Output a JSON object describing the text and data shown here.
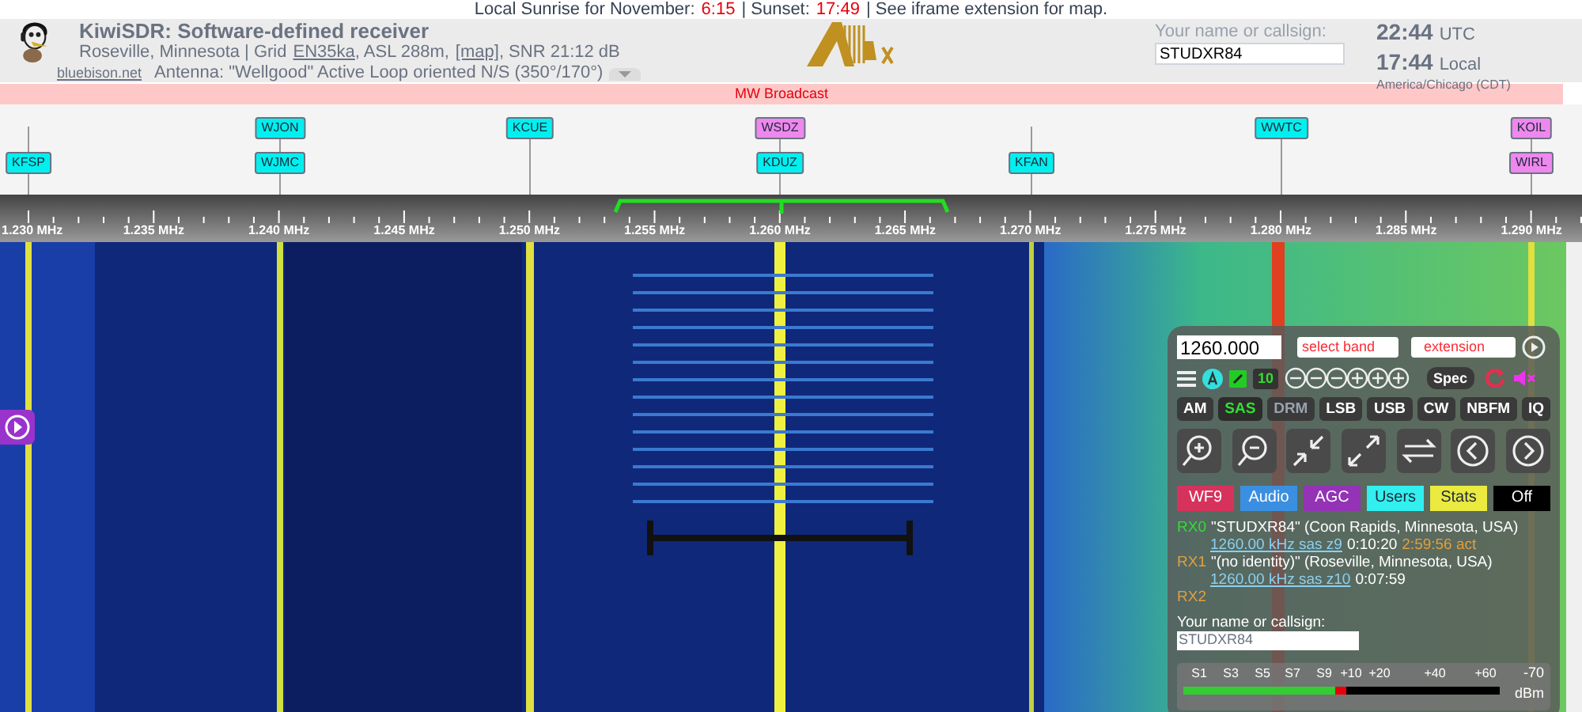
{
  "sun_line": {
    "sunrise_label": "Local Sunrise for November:",
    "sunrise": "6:15",
    "sunset_label": "| Sunset:",
    "sunset": "17:49",
    "note": "| See iframe extension for map."
  },
  "header": {
    "title": "KiwiSDR: Software-defined receiver",
    "location": "Roseville, Minnesota | Grid",
    "grid": "EN35ka",
    "asl": ", ASL 288m,",
    "map": "[map]",
    "snr": ", SNR 21:12 dB",
    "site": "bluebison.net",
    "antenna": "Antenna: \"Wellgood\" Active Loop oriented N/S (350°/170°)",
    "name_label": "Your name or callsign:",
    "name_value": "STUDXR84",
    "utc_time": "22:44",
    "utc_label": "UTC",
    "local_time": "17:44",
    "local_label": "Local",
    "timezone": "America/Chicago (CDT)"
  },
  "band": "MW Broadcast",
  "stations": [
    {
      "name": "KFSP",
      "color": "#00f0f0"
    },
    {
      "name": "WJON",
      "color": "#00f0f0"
    },
    {
      "name": "WJMC",
      "color": "#00f0f0"
    },
    {
      "name": "KCUE",
      "color": "#00f0f0"
    },
    {
      "name": "WSDZ",
      "color": "#ee88ee"
    },
    {
      "name": "KDUZ",
      "color": "#00f0f0"
    },
    {
      "name": "KFAN",
      "color": "#00f0f0"
    },
    {
      "name": "WWTC",
      "color": "#00f0f0"
    },
    {
      "name": "KOIL",
      "color": "#ee88ee"
    },
    {
      "name": "WIRL",
      "color": "#ee88ee"
    }
  ],
  "scale_labels": [
    "1.230 MHz",
    "1.235 MHz",
    "1.240 MHz",
    "1.245 MHz",
    "1.250 MHz",
    "1.255 MHz",
    "1.260 MHz",
    "1.265 MHz",
    "1.270 MHz",
    "1.275 MHz",
    "1.280 MHz",
    "1.285 MHz",
    "1.290 MHz"
  ],
  "panel": {
    "frequency": "1260.000",
    "band_select": "select band",
    "extension_select": "extension",
    "step": "10",
    "spec": "Spec",
    "modes": [
      {
        "label": "AM",
        "selected": false,
        "disabled": false
      },
      {
        "label": "SAS",
        "selected": true,
        "disabled": false
      },
      {
        "label": "DRM",
        "selected": false,
        "disabled": true
      },
      {
        "label": "LSB",
        "selected": false,
        "disabled": false
      },
      {
        "label": "USB",
        "selected": false,
        "disabled": false
      },
      {
        "label": "CW",
        "selected": false,
        "disabled": false
      },
      {
        "label": "NBFM",
        "selected": false,
        "disabled": false
      },
      {
        "label": "IQ",
        "selected": false,
        "disabled": false
      }
    ],
    "tabs": [
      {
        "label": "WF9",
        "color": "#d6335c"
      },
      {
        "label": "Audio",
        "color": "#3b8fe0"
      },
      {
        "label": "AGC",
        "color": "#9433b5"
      },
      {
        "label": "Users",
        "color": "#33f0f0"
      },
      {
        "label": "Stats",
        "color": "#eaea40"
      },
      {
        "label": "Off",
        "color": "#000000"
      }
    ],
    "users": [
      {
        "channel": "RX0",
        "name": "\"STUDXR84\" (Coon Rapids, Minnesota, USA)",
        "link": "1260.00 kHz sas z9",
        "time": "0:10:20",
        "extra": "2:59:56 act"
      },
      {
        "channel": "RX1",
        "name": "\"(no identity)\" (Roseville, Minnesota, USA)",
        "link": "1260.00 kHz sas z10",
        "time": "0:07:59"
      },
      {
        "channel": "RX2"
      }
    ],
    "name_label": "Your name or callsign:",
    "name_value": "STUDXR84",
    "smeter": {
      "labels": [
        "S1",
        "S3",
        "S5",
        "S7",
        "S9",
        "+10",
        "+20",
        "+40",
        "+60"
      ],
      "reading": "-70",
      "unit": "dBm",
      "level": 0.48
    }
  }
}
